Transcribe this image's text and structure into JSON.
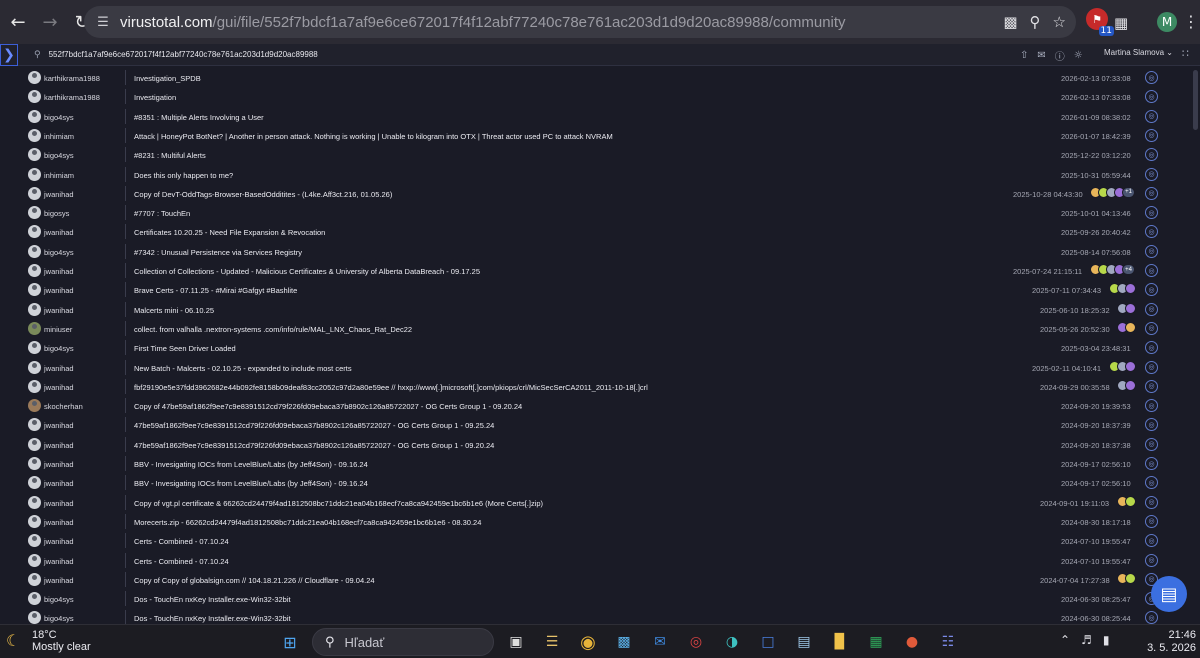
{
  "browser": {
    "url_host": "virustotal.com",
    "url_path": "/gui/file/552f7bdcf1a7af9e6ce672017f4f12abf77240c78e761ac203d1d9d20ac89988/community",
    "extension_badge_count": "11",
    "profile_initial": "M"
  },
  "vt": {
    "search_value": "552f7bdcf1a7af9e6ce672017f4f12abf77240c78e761ac203d1d9d20ac89988",
    "user_name": "Martina Slamova"
  },
  "rows": [
    {
      "user": "karthikrama1988",
      "title": "Investigation_SPDB",
      "date": "2026-02-13 07:33:08"
    },
    {
      "user": "karthikrama1988",
      "title": "Investigation",
      "date": "2026-02-13 07:33:08"
    },
    {
      "user": "bigo4sys",
      "title": "#8351 : Multiple Alerts Involving a User",
      "date": "2026-01-09 08:38:02"
    },
    {
      "user": "inhimiam",
      "title": "Attack | HoneyPot BotNet? | Another in person attack. Nothing is working | Unable to kilogram into OTX | Threat actor used PC to attack NVRAM",
      "date": "2026-01-07 18:42:39"
    },
    {
      "user": "bigo4sys",
      "title": "#8231 : Multiful Alerts",
      "date": "2025-12-22 03:12:20"
    },
    {
      "user": "inhimiam",
      "title": "Does this only happen to me?",
      "date": "2025-10-31 05:59:44"
    },
    {
      "user": "jwanihad",
      "title": "Copy of DevT-OddTags-Browser-BasedOdditites - (L4ke.Aff3ct.216, 01.05.26)",
      "date": "2025-10-28 04:43:30",
      "more": "+1"
    },
    {
      "user": "bigosys",
      "title": "#7707 : TouchEn",
      "date": "2025-10-01 04:13:46"
    },
    {
      "user": "jwanihad",
      "title": "Certificates 10.20.25 - Need File Expansion & Revocation",
      "date": "2025-09-26 20:40:42"
    },
    {
      "user": "bigo4sys",
      "title": "#7342 : Unusual Persistence via Services Registry",
      "date": "2025-08-14 07:56:08"
    },
    {
      "user": "jwanihad",
      "title": "Collection of Collections - Updated - Malicious Certificates & University of Alberta DataBreach - 09.17.25",
      "date": "2025-07-24 21:15:11",
      "more": "+4"
    },
    {
      "user": "jwanihad",
      "title": "Brave Certs - 07.11.25 - #Mirai #Gafgyt #Bashlite",
      "date": "2025-07-11 07:34:43"
    },
    {
      "user": "jwanihad",
      "title": "Malcerts mini - 06.10.25",
      "date": "2025-06-10 18:25:32"
    },
    {
      "user": "miniuser",
      "title": "collect. from valhalla .nextron-systems .com/info/rule/MAL_LNX_Chaos_Rat_Dec22",
      "date": "2025-05-26 20:52:30"
    },
    {
      "user": "bigo4sys",
      "title": "First Time Seen Driver Loaded",
      "date": "2025-03-04 23:48:31"
    },
    {
      "user": "jwanihad",
      "title": "New Batch - Malcerts - 02.10.25 - expanded to include most certs",
      "date": "2025-02-11 04:10:41"
    },
    {
      "user": "jwanihad",
      "title": "fbf29190e5e37fdd3962682e44b092fe8158b09deaf83cc2052c97d2a80e59ee // hxxp://www[.]microsoft[.]com/pkiops/crl/MicSecSerCA2011_2011-10-18[.]crl",
      "date": "2024-09-29 00:35:58"
    },
    {
      "user": "skocherhan",
      "title": "Copy of 47be59af1862f9ee7c9e8391512cd79f226fd09ebaca37b8902c126a85722027 - OG Certs Group 1 - 09.20.24",
      "date": "2024-09-20 19:39:53"
    },
    {
      "user": "jwanihad",
      "title": "47be59af1862f9ee7c9e8391512cd79f226fd09ebaca37b8902c126a85722027 - OG Certs Group 1 - 09.25.24",
      "date": "2024-09-20 18:37:39"
    },
    {
      "user": "jwanihad",
      "title": "47be59af1862f9ee7c9e8391512cd79f226fd09ebaca37b8902c126a85722027 - OG Certs Group 1 - 09.20.24",
      "date": "2024-09-20 18:37:38"
    },
    {
      "user": "jwanihad",
      "title": "BBV - Invesigating IOCs from LevelBlue/Labs (by Jeff4Son) - 09.16.24",
      "date": "2024-09-17 02:56:10"
    },
    {
      "user": "jwanihad",
      "title": "BBV - Invesigating IOCs from LevelBlue/Labs (by Jeff4Son) - 09.16.24",
      "date": "2024-09-17 02:56:10"
    },
    {
      "user": "jwanihad",
      "title": "Copy of vgt.pl certificate & 66262cd24479f4ad1812508bc71ddc21ea04b168ecf7ca8ca942459e1bc6b1e6 (More Certs[.]zip)",
      "date": "2024-09-01 19:11:03"
    },
    {
      "user": "jwanihad",
      "title": "Morecerts.zip - 66262cd24479f4ad1812508bc71ddc21ea04b168ecf7ca8ca942459e1bc6b1e6 - 08.30.24",
      "date": "2024-08-30 18:17:18"
    },
    {
      "user": "jwanihad",
      "title": "Certs - Combined - 07.10.24",
      "date": "2024-07-10 19:55:47"
    },
    {
      "user": "jwanihad",
      "title": "Certs - Combined - 07.10.24",
      "date": "2024-07-10 19:55:47"
    },
    {
      "user": "jwanihad",
      "title": "Copy of Copy of globalsign.com // 104.18.21.226 // Cloudflare - 09.04.24",
      "date": "2024-07-04 17:27:38"
    },
    {
      "user": "bigo4sys",
      "title": "Dos - TouchEn nxKey Installer.exe-Win32-32bit",
      "date": "2024-06-30 08:25:47"
    },
    {
      "user": "bigo4sys",
      "title": "Dos - TouchEn nxKey Installer.exe-Win32-32bit",
      "date": "2024-06-30 08:25:44"
    }
  ],
  "taskbar": {
    "temperature": "18°C",
    "condition": "Mostly clear",
    "search_label": "Hľadať",
    "time": "21:46",
    "date": "3. 5. 2026"
  }
}
